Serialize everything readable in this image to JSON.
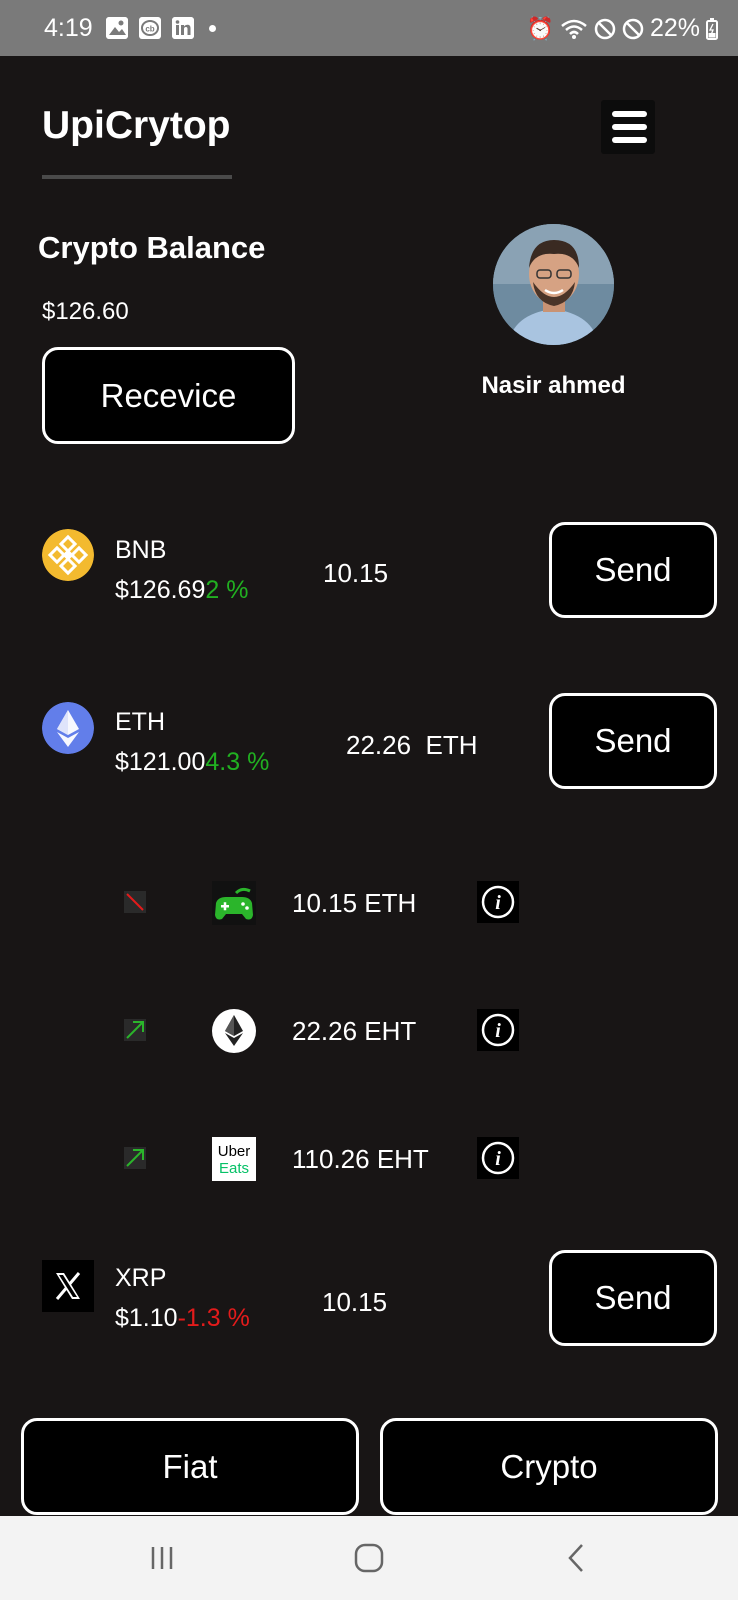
{
  "status_bar": {
    "time": "4:19",
    "battery": "22%",
    "notification_icons": [
      "gallery-icon",
      "cb-icon",
      "linkedin-icon",
      "dot-icon"
    ],
    "system_icons": [
      "alarm-icon",
      "wifi-icon",
      "do-not-disturb-icon",
      "no-sim-icon",
      "battery-icon"
    ]
  },
  "header": {
    "app_title": "UpiCrytop",
    "menu_icon": "hamburger-menu-icon"
  },
  "balance": {
    "label": "Crypto Balance",
    "value": "$126.60",
    "receive_label": "Recevice"
  },
  "profile": {
    "name": "Nasir ahmed"
  },
  "coins": [
    {
      "symbol": "BNB",
      "price": "$126.69",
      "change": "2 %",
      "change_dir": "up",
      "amount": "10.15",
      "send_label": "Send",
      "icon": "bnb-icon",
      "color": "#f3ba2f"
    },
    {
      "symbol": "ETH",
      "price": "$121.00",
      "change": "4.3 %",
      "change_dir": "up",
      "amount": "22.26  ETH",
      "send_label": "Send",
      "icon": "eth-icon",
      "color": "#627eea"
    },
    {
      "symbol": "XRP",
      "price": "$1.10",
      "change": "-1.3 %",
      "change_dir": "down",
      "amount": "10.15",
      "send_label": "Send",
      "icon": "x-icon",
      "color": "#000000"
    }
  ],
  "transactions": [
    {
      "direction": "down",
      "logo": "gamepad-icon",
      "amount": "10.15 ETH"
    },
    {
      "direction": "up",
      "logo": "ethereum-icon",
      "amount": "22.26 EHT"
    },
    {
      "direction": "up",
      "logo": "uber-eats-icon",
      "amount": "110.26 EHT",
      "logo_text_1": "Uber",
      "logo_text_2": "Eats"
    }
  ],
  "tabs": {
    "fiat_label": "Fiat",
    "crypto_label": "Crypto"
  },
  "colors": {
    "background": "#181515",
    "positive": "#21b021",
    "negative": "#e31b1b",
    "status_bar": "#7a7a7a"
  }
}
